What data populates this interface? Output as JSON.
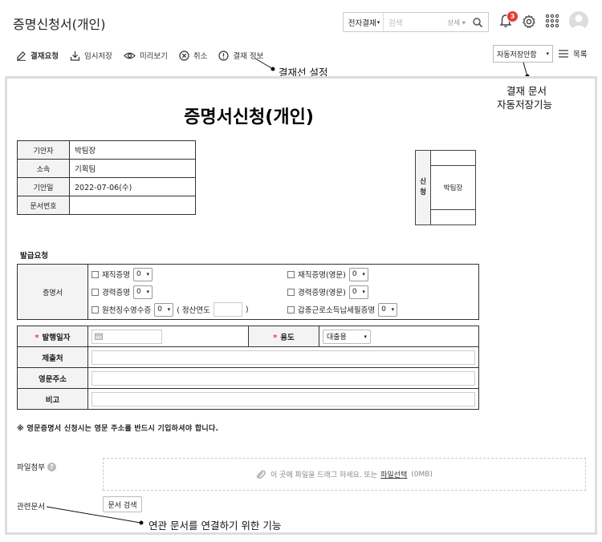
{
  "header": {
    "title": "증명신청서(개인)",
    "search_category": "전자결재",
    "search_placeholder": "검색",
    "search_detail": "상세",
    "notification_count": "3"
  },
  "toolbar": {
    "approve_request": "결재요청",
    "temp_save": "임시저장",
    "preview": "미리보기",
    "cancel": "취소",
    "approval_info": "결재 정보",
    "autosave_option": "자동저장안함",
    "list": "목록"
  },
  "annotations": {
    "approval_line": "결재선 설정",
    "autosave_line1": "결재 문서",
    "autosave_line2": "자동저장기능",
    "related_docs": "연관 문서를 연결하기 위한 기능"
  },
  "document": {
    "title": "증명서신청(개인)",
    "info": [
      {
        "label": "기안자",
        "value": "박팀장"
      },
      {
        "label": "소속",
        "value": "기획팀"
      },
      {
        "label": "기안일",
        "value": "2022-07-06(수)"
      },
      {
        "label": "문서번호",
        "value": ""
      }
    ],
    "sign": {
      "label_1": "신",
      "label_2": "청",
      "signer": "박팀장"
    },
    "issue_section": "발급요청",
    "cert_label": "증명서",
    "cert_options": {
      "employment": "재직증명",
      "employment_en": "재직증명(영문)",
      "career": "경력증명",
      "career_en": "경력증명(영문)",
      "withholding": "원천징수영수증",
      "settlement_year_open": "( 정산연도",
      "settlement_year_close": ")",
      "income_tax": "갑종근로소득납세필증명",
      "default_qty": "0"
    },
    "form": {
      "issue_date_label": "발행일자",
      "purpose_label": "용도",
      "purpose_value": "대출용",
      "submit_to_label": "제출처",
      "en_address_label": "영문주소",
      "note_label": "비고",
      "required_mark": "*"
    },
    "notice": "※ 영문증명서 신청시는 영문 주소를 반드시 기입하셔야 합니다.",
    "attachment": {
      "label": "파일첨부",
      "help": "?",
      "drop_text": "이 곳에 파일을 드래그 하세요. 또는",
      "select_link": "파일선택",
      "size": "(0MB)"
    },
    "related": {
      "label": "관련문서",
      "button": "문서 검색"
    }
  }
}
